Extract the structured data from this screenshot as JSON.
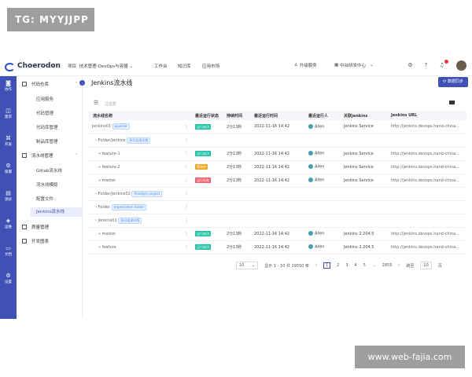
{
  "overlay": {
    "tg_label": "TG: MYYJJPP",
    "site_label": "www.web-fajia.com"
  },
  "topbar": {
    "app_name": "Choerodon",
    "project_label": "项目: 技术管理-DevOps与容器",
    "nav": [
      "工作台",
      "知识库",
      "应用市场"
    ],
    "upgrade_label": "升级服务",
    "org_label": "中台研发中心",
    "icons": [
      "settings-icon",
      "help-icon",
      "bell-icon"
    ]
  },
  "leftbar": {
    "items": [
      "协作",
      "需求",
      "开发",
      "部署",
      "测试",
      "运维",
      "文档",
      "设置"
    ]
  },
  "menu": {
    "groups": [
      {
        "label": "代码仓库",
        "items": [
          "应用服务",
          "代码管理",
          "代码库管理",
          "制品库管理"
        ]
      },
      {
        "label": "流水线管理",
        "items": [
          "Gitlab流水线",
          "流水线模版",
          "配置文件",
          "Jenkins流水线"
        ]
      },
      {
        "label": "质量管理",
        "items": []
      },
      {
        "label": "开发图表",
        "items": []
      }
    ]
  },
  "page": {
    "title": "Jenkins流水线",
    "sync_button": "数据同步",
    "filter_placeholder": "过滤表"
  },
  "table": {
    "headers": [
      "流水线名称",
      "",
      "最近运行状态",
      "持续时间",
      "最近运行时间",
      "最近运行人",
      "关联Jenkins",
      "Jenkins URL"
    ],
    "rows": [
      {
        "name": "Jenkins01",
        "tag": "pipeline",
        "status": "运行成功",
        "status_color": "#1fc2a4",
        "duration": "2分13秒",
        "time": "2022-11-16 14:42",
        "user": "Allen",
        "jenkins": "Jenkins Service",
        "url": "http://jenkins.devops.hand-china..."
      },
      {
        "name": "Folder/Jenkins",
        "tag": "多分支流水线",
        "status": "",
        "status_color": "",
        "duration": "",
        "time": "",
        "user": "",
        "jenkins": "",
        "url": ""
      },
      {
        "name": "feature-1",
        "tag": "",
        "status": "运行成功",
        "status_color": "#1fc2a4",
        "duration": "2分13秒",
        "time": "2022-11-16 14:42",
        "user": "Allen",
        "jenkins": "Jenkins Service",
        "url": "http://jenkins.devops.hand-china..."
      },
      {
        "name": "feature-2",
        "tag": "",
        "status": "等待中",
        "status_color": "#f5a623",
        "duration": "2分13秒",
        "time": "2022-11-16 14:42",
        "user": "Allen",
        "jenkins": "Jenkins Service",
        "url": "http://jenkins.devops.hand-china..."
      },
      {
        "name": "master",
        "tag": "",
        "status": "运行失败",
        "status_color": "#f45d6e",
        "duration": "2分13秒",
        "time": "2022-11-16 14:42",
        "user": "Allen",
        "jenkins": "Jenkins Service",
        "url": "http://jenkins.devops.hand-china..."
      },
      {
        "name": "Folder/Jenkins02",
        "tag": "freestyle project",
        "status": "",
        "status_color": "",
        "duration": "",
        "time": "",
        "user": "",
        "jenkins": "",
        "url": ""
      },
      {
        "name": "Folder",
        "tag": "organization Folder",
        "status": "",
        "status_color": "",
        "duration": "",
        "time": "",
        "user": "",
        "jenkins": "",
        "url": ""
      },
      {
        "name": "Jenkins01",
        "tag": "多分支流水线",
        "status": "",
        "status_color": "",
        "duration": "",
        "time": "",
        "user": "",
        "jenkins": "",
        "url": ""
      },
      {
        "name": "master",
        "tag": "",
        "status": "运行成功",
        "status_color": "#1fc2a4",
        "duration": "2分13秒",
        "time": "2022-11-16 14:42",
        "user": "Allen",
        "jenkins": "Jenkins 2.204.5",
        "url": "http://jenkins.devops.hand-china..."
      },
      {
        "name": "feature",
        "tag": "",
        "status": "运行成功",
        "status_color": "#1fc2a4",
        "duration": "2分13秒",
        "time": "2022-11-16 14:42",
        "user": "Allen",
        "jenkins": "Jenkins 2.204.5",
        "url": "http://jenkins.devops.hand-china..."
      }
    ]
  },
  "pager": {
    "page_size": "10",
    "summary": "显示 1 - 10 共 29550 条",
    "pages": [
      "1",
      "2",
      "3",
      "4",
      "5",
      "...",
      "2855"
    ],
    "goto_label": "跳至",
    "goto_value": "10",
    "page_suffix": "页"
  }
}
